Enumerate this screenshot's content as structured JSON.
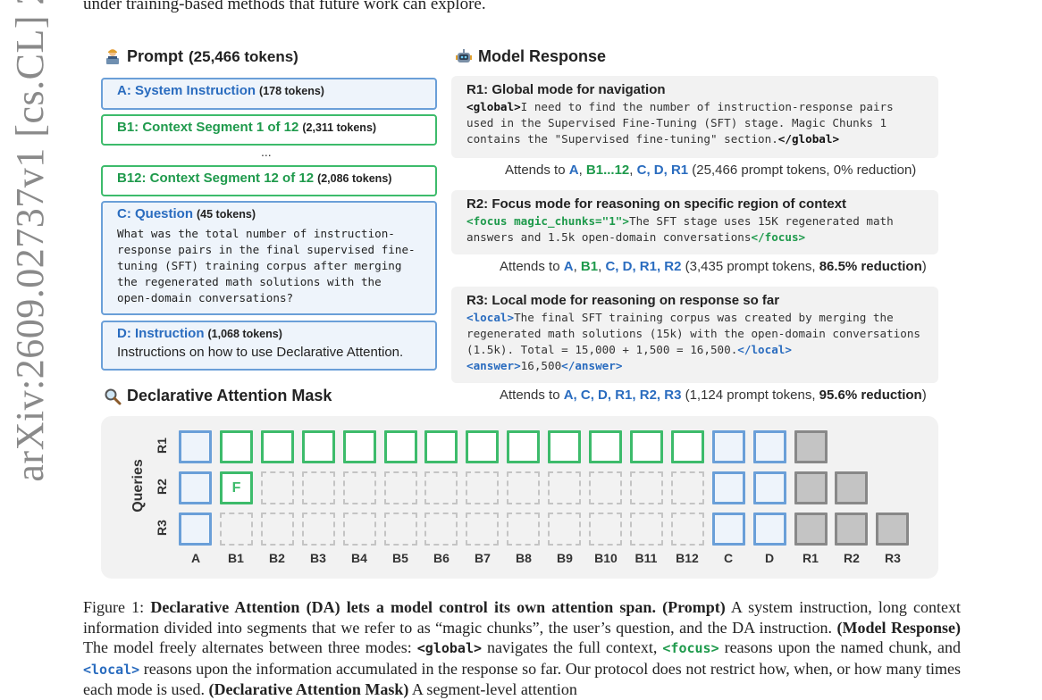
{
  "arxiv_stamp": "arXiv:2609.02737v1  [cs.CL]  2",
  "top_line": "under training-based methods that future work can explore.",
  "prompt": {
    "title": "Prompt",
    "tokens": "(25,466 tokens)",
    "icon": "person-at-computer-icon",
    "boxes": {
      "a": {
        "label": "A: System Instruction",
        "tokens": "(178 tokens)"
      },
      "b1": {
        "label": "B1: Context Segment 1 of 12",
        "tokens": "(2,311 tokens)"
      },
      "ellipsis": "...",
      "b12": {
        "label": "B12: Context Segment 12 of 12",
        "tokens": "(2,086 tokens)"
      },
      "c": {
        "label": "C: Question",
        "tokens": "(45 tokens)",
        "text": "What was the total number of instruction-\nresponse pairs in the final supervised fine-\ntuning (SFT) training corpus after merging\nthe regenerated math solutions with the\nopen-domain conversations?"
      },
      "d": {
        "label": "D: Instruction",
        "tokens": "(1,068 tokens)",
        "text": "Instructions on how to  use Declarative Attention."
      }
    }
  },
  "response": {
    "title": "Model Response",
    "icon": "robot-icon",
    "r1": {
      "title": "R1: Global mode for navigation",
      "open_tag": "<global>",
      "text": "I need to find the number of instruction-response pairs used in the Supervised Fine-Tuning (SFT) stage. Magic Chunks 1 contains the \"Supervised fine-tuning\" section.",
      "close_tag": "</global>",
      "attends_prefix": "Attends to ",
      "attends_a": "A",
      "attends_b": "B1...12",
      "attends_rest_blue": "C, D, R1",
      "attends_suffix": " (25,466 prompt tokens, 0% reduction)"
    },
    "r2": {
      "title": "R2: Focus mode for reasoning on specific region of context",
      "open_tag": "<focus magic_chunks=\"1\">",
      "text": "The SFT stage uses 15K regenerated math answers and 1.5k open-domain conversations",
      "close_tag": "</focus>",
      "attends_prefix": "Attends to ",
      "attends_a": "A",
      "attends_b": "B1",
      "attends_rest_blue": "C, D, R1, R2",
      "attends_suffix_1": " (3,435 prompt tokens, ",
      "attends_reduction": "86.5% reduction",
      "attends_suffix_2": ")"
    },
    "r3": {
      "title": "R3: Local mode for reasoning on response so far",
      "open_tag": "<local>",
      "text": "The final SFT training corpus was created by merging the regenerated math solutions (15k) with the open-domain conversations (1.5k). Total = 15,000 + 1,500 = 16,500.",
      "close_tag": "</local>",
      "answer_open": "<answer>",
      "answer_text": "16,500",
      "answer_close": "</answer>",
      "attends_prefix": "Attends to ",
      "attends_rest_blue": "A, C, D, R1, R2, R3",
      "attends_suffix_1": " (1,124 prompt tokens, ",
      "attends_reduction": "95.6% reduction",
      "attends_suffix_2": ")"
    }
  },
  "mask": {
    "title": "Declarative Attention Mask",
    "icon": "magnifying-glass-icon",
    "y_label": "Queries",
    "rows": [
      "R1",
      "R2",
      "R3"
    ],
    "columns": [
      "A",
      "B1",
      "B2",
      "B3",
      "B4",
      "B5",
      "B6",
      "B7",
      "B8",
      "B9",
      "B10",
      "B11",
      "B12",
      "C",
      "D",
      "R1",
      "R2",
      "R3"
    ],
    "focus_label": "F",
    "cells": [
      [
        "blue",
        "green",
        "green",
        "green",
        "green",
        "green",
        "green",
        "green",
        "green",
        "green",
        "green",
        "green",
        "green",
        "blue",
        "blue",
        "grey",
        "none",
        "none"
      ],
      [
        "blue",
        "focus",
        "empty",
        "empty",
        "empty",
        "empty",
        "empty",
        "empty",
        "empty",
        "empty",
        "empty",
        "empty",
        "empty",
        "blue",
        "blue",
        "grey",
        "grey",
        "none"
      ],
      [
        "blue",
        "empty",
        "empty",
        "empty",
        "empty",
        "empty",
        "empty",
        "empty",
        "empty",
        "empty",
        "empty",
        "empty",
        "empty",
        "blue",
        "blue",
        "grey",
        "grey",
        "grey"
      ]
    ]
  },
  "caption": {
    "fig_label": "Figure",
    "fig_num": "1:",
    "headline": "Declarative Attention (DA) lets a model control its own attention span.",
    "p1_tag": "(Prompt)",
    "p1_text": " A system instruction, long context information divided into segments that we refer to as “magic chunks”, the user’s question, and the DA instruction. ",
    "p2_tag": "(Model Response)",
    "p2_text_1": " The model freely alternates between three modes: ",
    "tag_global": "<global>",
    "p2_text_2": " navigates the full context, ",
    "tag_focus": "<focus>",
    "p2_text_3": " reasons upon the named chunk, and ",
    "tag_local": "<local>",
    "p2_text_4": " reasons upon the information accumulated in the response so far. Our protocol does not restrict how, when, or how many times each mode is used. ",
    "p3_tag": "(Declarative Attention Mask)",
    "p3_text": " A segment-level attention"
  },
  "colors": {
    "blue": "#2a6cbf",
    "blue_border": "#6a9fd8",
    "green": "#1f9a4c",
    "green_border": "#3dbb6b",
    "grey_cell": "#c4c4c4"
  }
}
